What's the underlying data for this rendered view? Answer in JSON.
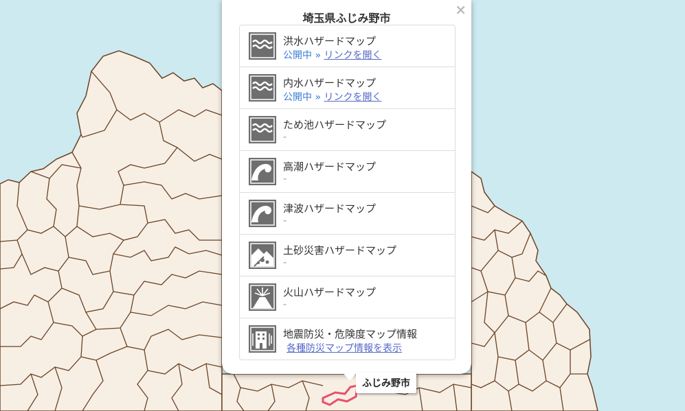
{
  "popup": {
    "title": "埼玉県ふじみ野市",
    "close": "×",
    "items": [
      {
        "name": "洪水ハザードマップ",
        "status": "公開中 »",
        "link": "リンクを開く",
        "icon": "flood-waves-icon"
      },
      {
        "name": "内水ハザードマップ",
        "status": "公開中 »",
        "link": "リンクを開く",
        "icon": "flood-waves-icon"
      },
      {
        "name": "ため池ハザードマップ",
        "status": "-",
        "icon": "reservoir-waves-icon"
      },
      {
        "name": "高潮ハザードマップ",
        "status": "-",
        "icon": "storm-surge-wave-icon"
      },
      {
        "name": "津波ハザードマップ",
        "status": "-",
        "icon": "tsunami-wave-icon"
      },
      {
        "name": "土砂災害ハザードマップ",
        "status": "-",
        "icon": "landslide-icon"
      },
      {
        "name": "火山ハザードマップ",
        "status": "-",
        "icon": "volcano-icon"
      },
      {
        "name": "地震防災・危険度マップ情報",
        "link": "各種防災マップ情報を表示",
        "icon": "building-icon"
      }
    ]
  },
  "map": {
    "city_label": "ふじみ野市",
    "colors": {
      "sea": "#cdeaf0",
      "land": "#f7efe4",
      "border": "#6b4226",
      "highlight": "#e8506a"
    }
  }
}
